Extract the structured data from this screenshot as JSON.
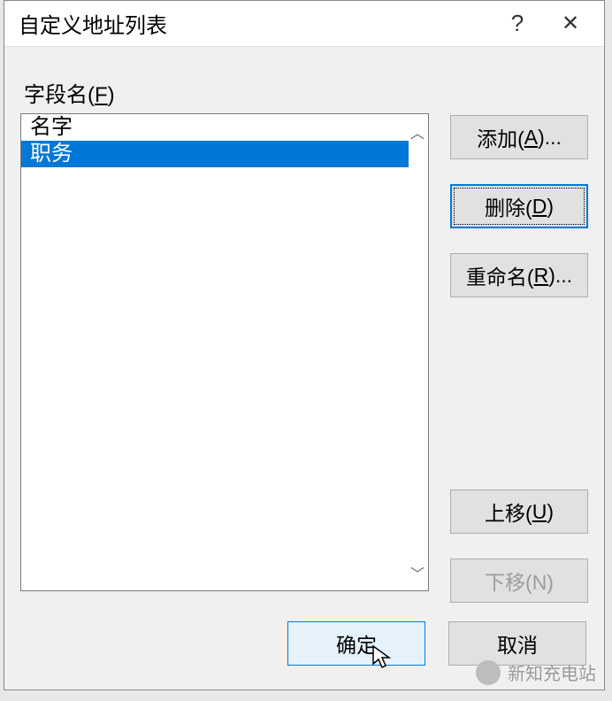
{
  "window": {
    "title": "自定义地址列表",
    "help": "?",
    "close": "✕"
  },
  "form": {
    "field_label_pre": "字段名(",
    "field_label_u": "F",
    "field_label_post": ")"
  },
  "list": {
    "items": [
      {
        "label": "名字",
        "selected": false
      },
      {
        "label": "职务",
        "selected": true
      }
    ],
    "scroll_up": "︿",
    "scroll_down": "﹀"
  },
  "buttons": {
    "add_pre": "添加(",
    "add_u": "A",
    "add_post": ")...",
    "delete_pre": "删除(",
    "delete_u": "D",
    "delete_post": ")",
    "rename_pre": "重命名(",
    "rename_u": "R",
    "rename_post": ")...",
    "moveup_pre": "上移(",
    "moveup_u": "U",
    "moveup_post": ")",
    "movedown": "下移(N)",
    "ok": "确定",
    "cancel": "取消"
  },
  "watermark": "新知充电站"
}
